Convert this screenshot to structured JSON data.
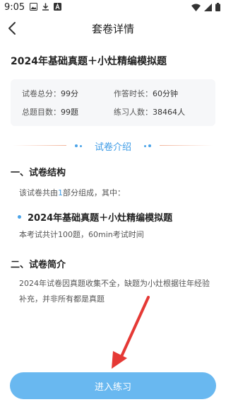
{
  "status_bar": {
    "time": "9:05"
  },
  "nav": {
    "title": "套卷详情"
  },
  "paper": {
    "title": "2024年基础真题＋小灶精编模拟题"
  },
  "info": {
    "total_score_label": "试卷总分：",
    "total_score_value": "99分",
    "duration_label": "作答时长：",
    "duration_value": "60分钟",
    "question_count_label": "总题目数：",
    "question_count_value": "99题",
    "practice_count_label": "练习人数：",
    "practice_count_value": "38464人"
  },
  "section_divider": {
    "label": "试卷介绍"
  },
  "structure": {
    "heading": "一、试卷结构",
    "desc_prefix": "该试卷共由",
    "desc_count": "1",
    "desc_suffix": "部分组成，其中：",
    "part_title": "2024年基础真题＋小灶精编模拟题",
    "part_desc": "本考试共计100题，60min考试时间"
  },
  "intro": {
    "heading": "二、试卷简介",
    "text": "2024年试卷因真题收集不全，缺题为小灶根据往年经验补充，并非所有都是真题"
  },
  "action": {
    "start_label": "进入练习"
  },
  "colors": {
    "accent": "#3d9be6",
    "button": "#69b8f0",
    "arrow": "#e53935"
  }
}
